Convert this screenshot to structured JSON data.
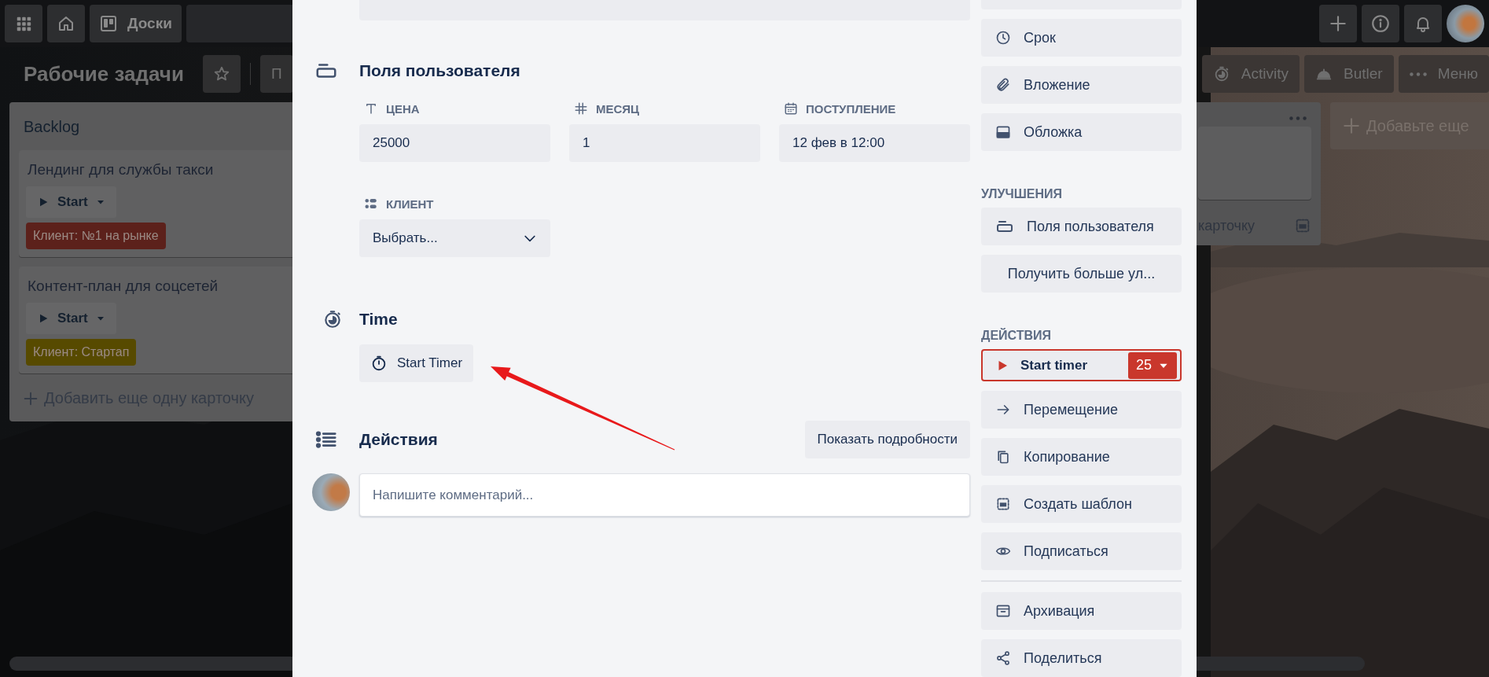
{
  "top_bar": {
    "boards_button": "Доски"
  },
  "board_header": {
    "title": "Рабочие задачи",
    "cut_button": "П",
    "buttons": [
      {
        "label": "Activity"
      },
      {
        "label": "Butler"
      },
      {
        "label": "Меню"
      }
    ]
  },
  "lists": [
    {
      "title": "Backlog",
      "cards": [
        {
          "title": "Лендинг для службы такси",
          "timer_button": "Start",
          "labels": [
            {
              "text": "Клиент: №1 на рынке",
              "color": "#5c211b"
            }
          ]
        },
        {
          "title": "Контент-план для соцсетей",
          "timer_button": "Start",
          "labels": [
            {
              "text": "Клиент: Стартап",
              "color": "#574a00"
            }
          ]
        }
      ],
      "add_card": "Добавить еще одну карточку"
    },
    {
      "add_card": "карточку"
    }
  ],
  "add_list": "Добавьте еще",
  "card_modal": {
    "custom_fields": {
      "heading": "Поля пользователя",
      "fields": [
        {
          "kind": "text",
          "label": "ЦЕНА",
          "value": "25000"
        },
        {
          "kind": "number",
          "label": "МЕСЯЦ",
          "value": "1"
        },
        {
          "kind": "date",
          "label": "ПОСТУПЛЕНИЕ",
          "value": "12 фев в 12:00"
        },
        {
          "kind": "dropdown",
          "label": "КЛИЕНТ",
          "value": "Выбрать..."
        }
      ]
    },
    "time": {
      "heading": "Time",
      "button": "Start Timer"
    },
    "activity": {
      "heading": "Действия",
      "details_button": "Показать подробности",
      "comment_placeholder": "Напишите комментарий..."
    },
    "sidebar": [
      {
        "kind": "button",
        "label": "Срок"
      },
      {
        "kind": "button",
        "label": "Вложение"
      },
      {
        "kind": "button",
        "label": "Обложка"
      },
      {
        "kind": "heading",
        "label": "УЛУЧШЕНИЯ"
      },
      {
        "kind": "button",
        "label": "Поля пользователя"
      },
      {
        "kind": "button",
        "label": "Получить больше ул..."
      },
      {
        "kind": "heading",
        "label": "ДЕЙСТВИЯ"
      },
      {
        "kind": "timer",
        "label": "Start timer",
        "count": "25"
      },
      {
        "kind": "button",
        "label": "Перемещение"
      },
      {
        "kind": "button",
        "label": "Копирование"
      },
      {
        "kind": "button",
        "label": "Создать шаблон"
      },
      {
        "kind": "button",
        "label": "Подписаться"
      },
      {
        "kind": "divider"
      },
      {
        "kind": "button",
        "label": "Архивация"
      },
      {
        "kind": "button",
        "label": "Поделиться"
      }
    ]
  }
}
